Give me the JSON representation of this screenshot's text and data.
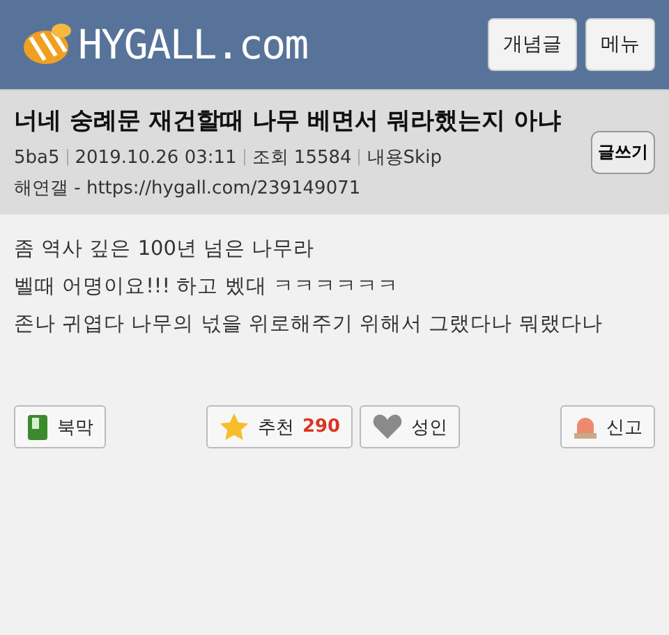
{
  "header": {
    "logo": "HYGALL.com",
    "buttons": [
      "개념글",
      "메뉴"
    ]
  },
  "post": {
    "title": "너네 숭례문 재건할때 나무 베면서 뭐라했는지 아냐",
    "meta": [
      "5ba5",
      "2019.10.26 03:11",
      "조회 15584",
      "내용Skip"
    ],
    "source": "해연갤 - https://hygall.com/239149071",
    "write_button": "글쓰기"
  },
  "body": [
    "좀 역사 깊은 100년 넘은 나무라",
    "벨때 어명이요!!! 하고 벴대 ㅋㅋㅋㅋㅋㅋ",
    "존나 귀엽다 나무의 넋을 위로해주기 위해서 그랬다나 뭐랬다나"
  ],
  "actions": [
    {
      "kind": "bookmark",
      "label": "북막"
    },
    {
      "kind": "recommend",
      "label": "추천",
      "count": "290"
    },
    {
      "kind": "adult",
      "label": "성인"
    },
    {
      "kind": "report",
      "label": "신고"
    }
  ]
}
